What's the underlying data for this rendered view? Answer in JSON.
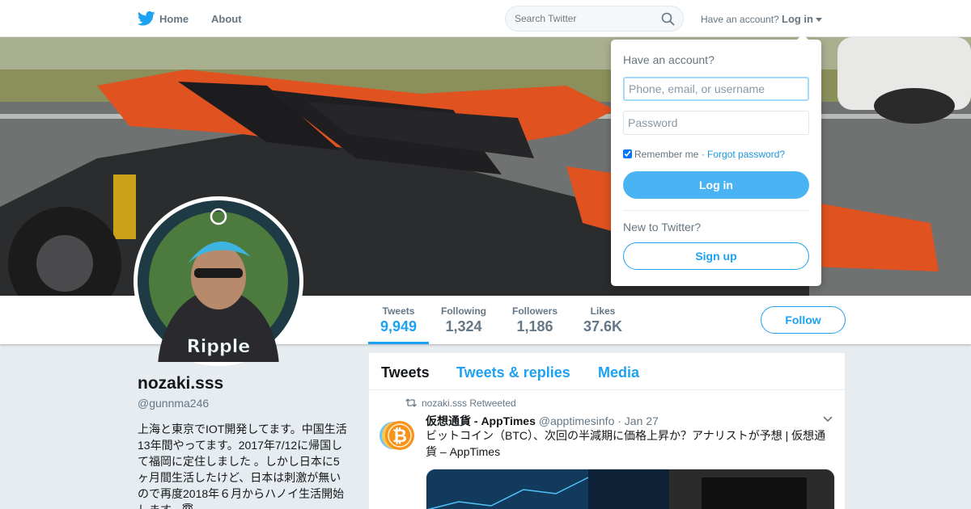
{
  "nav": {
    "home": "Home",
    "about": "About",
    "search_placeholder": "Search Twitter",
    "have_account": "Have an account?",
    "login": "Log in"
  },
  "login_dropdown": {
    "title": "Have an account?",
    "username_placeholder": "Phone, email, or username",
    "password_placeholder": "Password",
    "remember_me": "Remember me",
    "separator": " · ",
    "forgot_password": "Forgot password?",
    "login_button": "Log in",
    "new_to_twitter": "New to Twitter?",
    "signup_button": "Sign up"
  },
  "profile": {
    "name": "nozaki.sss",
    "handle": "@gunnma246",
    "bio": "上海と東京でIOT開発してます。中国生活13年間やってます。2017年7/12に帰国して福岡に定住しました 。しかし日本に5ヶ月間生活したけど、日本は刺激が無いので再度2018年６月からハノイ生活開始します。😇",
    "avatar_label": "Ripple",
    "stats": [
      {
        "label": "Tweets",
        "value": "9,949"
      },
      {
        "label": "Following",
        "value": "1,324"
      },
      {
        "label": "Followers",
        "value": "1,186"
      },
      {
        "label": "Likes",
        "value": "37.6K"
      }
    ],
    "follow_button": "Follow"
  },
  "timeline": {
    "tabs": [
      "Tweets",
      "Tweets & replies",
      "Media"
    ],
    "tweet": {
      "retweeted_by": "nozaki.sss Retweeted",
      "author_name": "仮想通貨 - AppTimes",
      "author_handle": "@apptimesinfo",
      "date": "· Jan 27",
      "text": "ビットコイン（BTC）、次回の半減期に価格上昇か？アナリストが予想 | 仮想通貨 – AppTimes",
      "avatar_glyph": "₿"
    }
  },
  "colors": {
    "brand_blue": "#1da1f2",
    "login_blue": "#4ab3f4",
    "muted": "#657786",
    "background": "#e6ecf0"
  },
  "icons": [
    "twitter-bird-icon",
    "search-icon",
    "caret-down-icon",
    "retweet-icon",
    "chevron-down-icon",
    "checkbox-icon"
  ]
}
